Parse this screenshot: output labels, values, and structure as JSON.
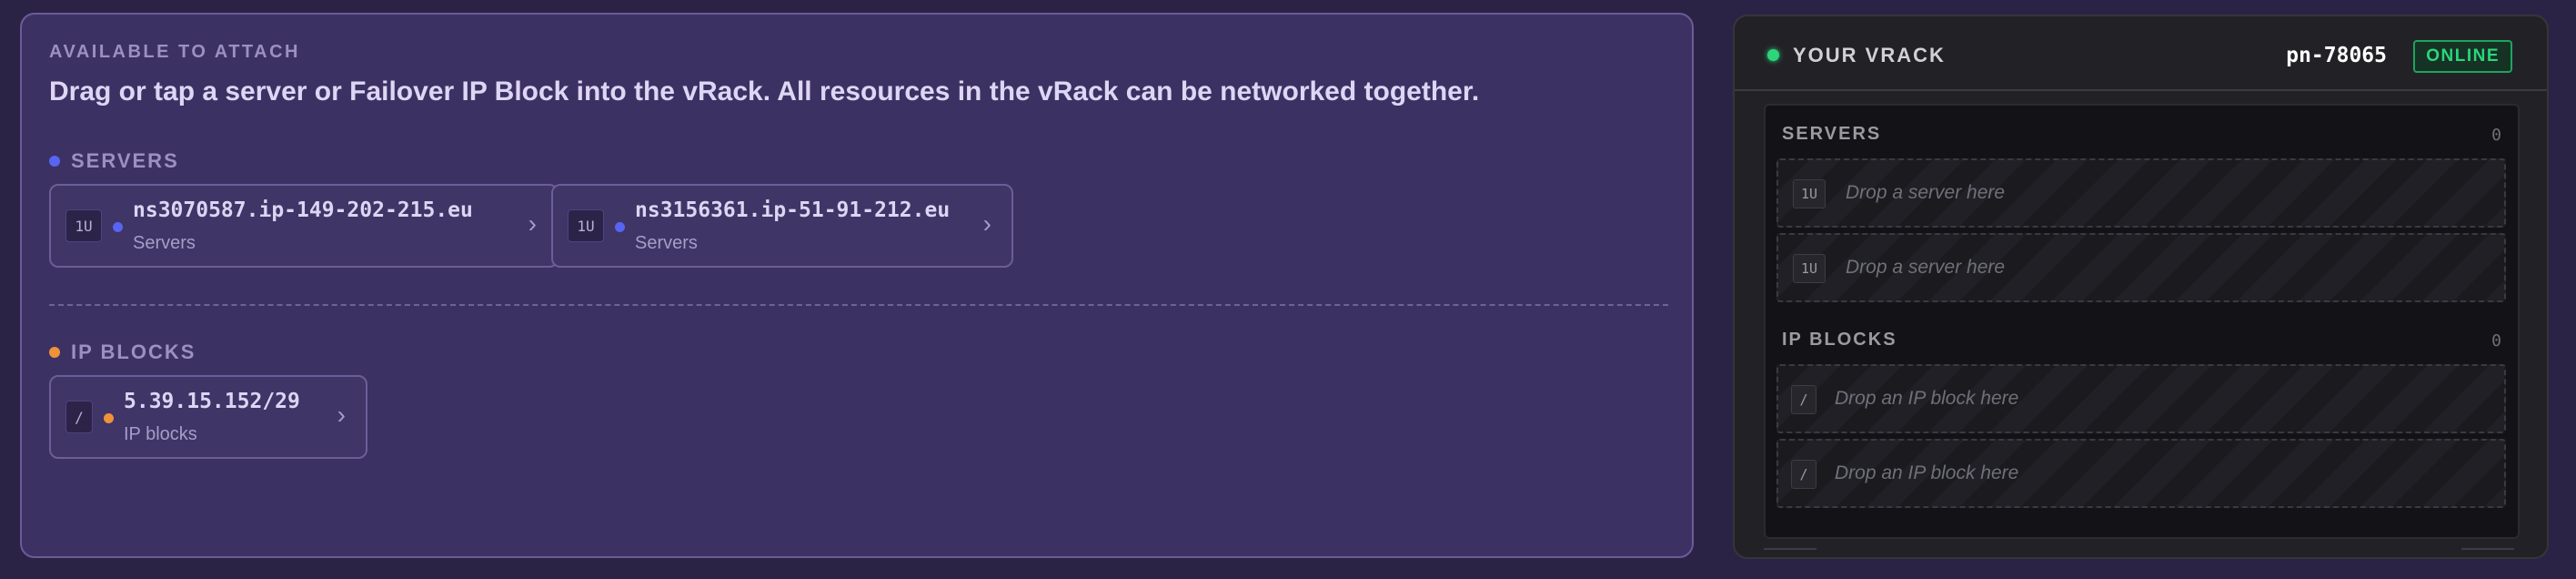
{
  "available": {
    "kicker": "AVAILABLE TO ATTACH",
    "headline": "Drag or tap a server or Failover IP Block into the vRack. All resources in the vRack can be networked together.",
    "servers_label": "SERVERS",
    "servers": [
      {
        "badge": "1U",
        "name": "ns3070587.ip-149-202-215.eu",
        "type": "Servers"
      },
      {
        "badge": "1U",
        "name": "ns3156361.ip-51-91-212.eu",
        "type": "Servers"
      }
    ],
    "ipblocks_label": "IP BLOCKS",
    "ipblocks": [
      {
        "badge": "/",
        "name": "5.39.15.152/29",
        "type": "IP blocks"
      }
    ]
  },
  "vrack": {
    "title": "YOUR VRACK",
    "id": "pn-78065",
    "status": "ONLINE",
    "servers_label": "SERVERS",
    "servers_count": "0",
    "server_slots": [
      {
        "badge": "1U",
        "text": "Drop a server here"
      },
      {
        "badge": "1U",
        "text": "Drop a server here"
      }
    ],
    "ipblocks_label": "IP BLOCKS",
    "ipblocks_count": "0",
    "ip_slots": [
      {
        "badge": "/",
        "text": "Drop an IP block here"
      },
      {
        "badge": "/",
        "text": "Drop an IP block here"
      }
    ]
  },
  "colors": {
    "server_dot": "#5865f2",
    "ipblock_dot": "#f0923a",
    "online": "#2bd67b"
  },
  "icons": {
    "card_arrow": "chevron-right-icon",
    "status_led": "status-led-icon"
  }
}
